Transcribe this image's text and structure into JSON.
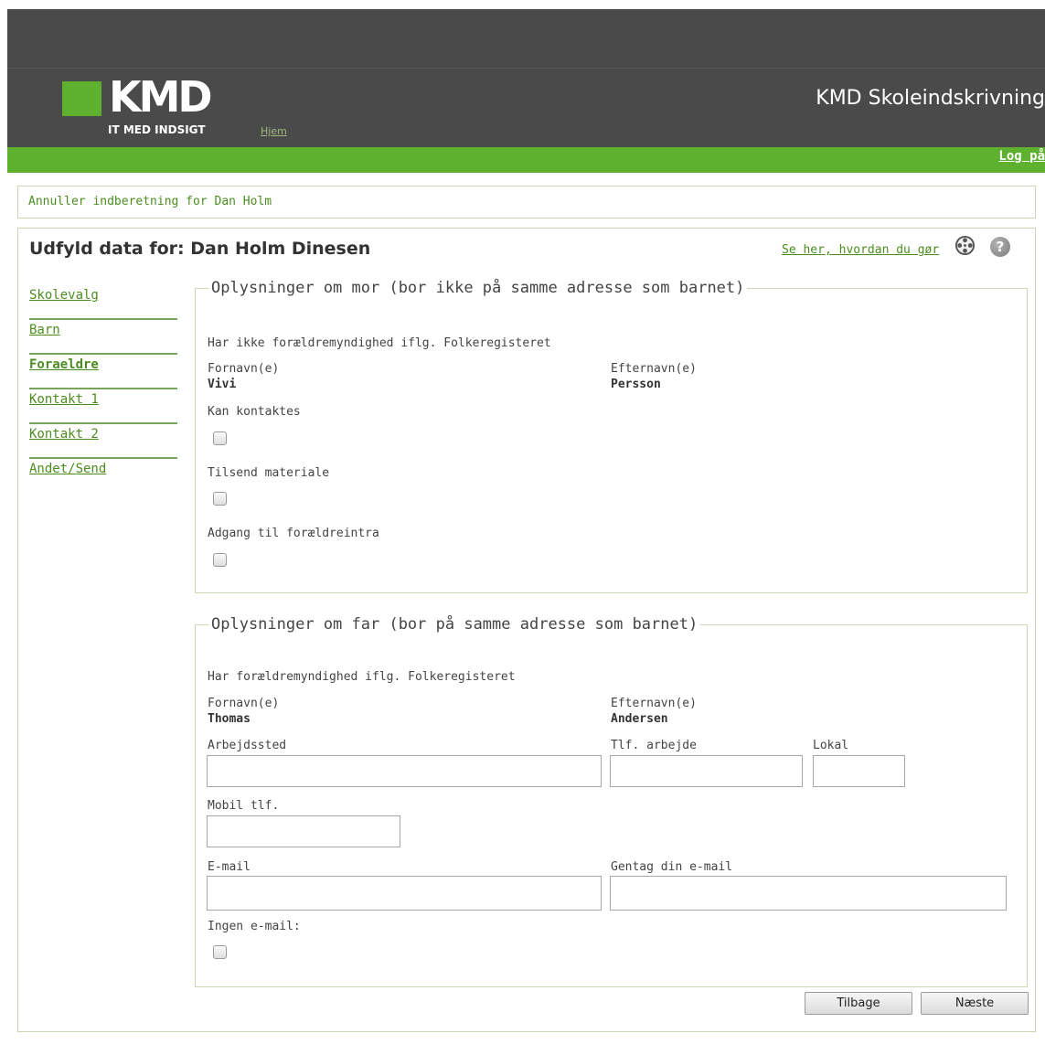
{
  "header": {
    "logo_text": "KMD",
    "logo_tagline": "IT MED INDSIGT",
    "home_link": "Hjem",
    "app_title": "KMD Skoleindskrivning",
    "login_link": "Log på",
    "brand_color": "#5db12f",
    "header_color": "#4a4a4a"
  },
  "cancel_link": "Annuller indberetning for Dan Holm",
  "page_title": "Udfyld data for: Dan Holm Dinesen",
  "help_link": "Se her, hvordan du gør",
  "icons": [
    "film-reel-icon",
    "help-icon"
  ],
  "help_icon_glyph": "?",
  "nav": {
    "items": [
      {
        "label": "Skolevalg"
      },
      {
        "label": "Barn"
      },
      {
        "label": "Foraeldre"
      },
      {
        "label": "Kontakt 1"
      },
      {
        "label": "Kontakt 2"
      },
      {
        "label": "Andet/Send"
      }
    ]
  },
  "mother": {
    "legend": "Oplysninger om mor (bor ikke på samme adresse som barnet)",
    "custody": "Har ikke forældremyndighed iflg. Folkeregisteret",
    "firstname_label": "Fornavn(e)",
    "firstname": "Vivi",
    "lastname_label": "Efternavn(e)",
    "lastname": "Persson",
    "can_contact_label": "Kan kontaktes",
    "send_material_label": "Tilsend materiale",
    "parent_intra_label": "Adgang til forældreintra"
  },
  "father": {
    "legend": "Oplysninger om far (bor på samme adresse som barnet)",
    "custody": "Har forældremyndighed iflg. Folkeregisteret",
    "firstname_label": "Fornavn(e)",
    "firstname": "Thomas",
    "lastname_label": "Efternavn(e)",
    "lastname": "Andersen",
    "workplace_label": "Arbejdssted",
    "work_phone_label": "Tlf. arbejde",
    "local_label": "Lokal",
    "mobile_label": "Mobil tlf.",
    "email_label": "E-mail",
    "email_repeat_label": "Gentag din e-mail",
    "no_email_label": "Ingen e-mail:"
  },
  "buttons": {
    "back": "Tilbage",
    "next": "Næste"
  }
}
